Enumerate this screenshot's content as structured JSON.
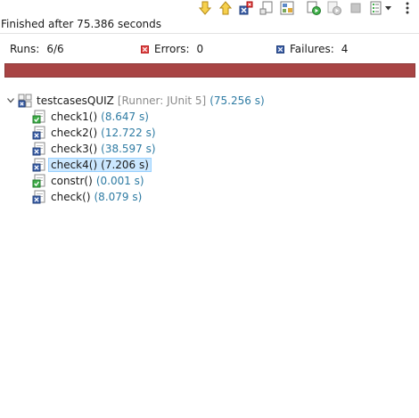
{
  "status": {
    "message": "Finished after 75.386 seconds"
  },
  "counters": {
    "runs_label": "Runs:",
    "runs_value": "6/6",
    "errors_label": "Errors:",
    "errors_value": "0",
    "failures_label": "Failures:",
    "failures_value": "4"
  },
  "progress": {
    "failed": true,
    "fraction": 1.0,
    "color": "#a84444"
  },
  "toolbar": {
    "icons": [
      "next-failure-icon",
      "previous-failure-icon",
      "show-failures-only-icon",
      "scroll-lock-icon",
      "layout-icon",
      "rerun-icon",
      "rerun-failed-first-icon",
      "stop-icon",
      "test-run-history-icon",
      "view-menu-icon"
    ]
  },
  "tree": {
    "root": {
      "label": "testcasesQUIZ",
      "runner": "[Runner: JUnit 5]",
      "time": "(75.256 s)",
      "status": "failed"
    },
    "children": [
      {
        "label": "check1()",
        "time": "(8.647 s)",
        "status": "passed",
        "selected": false
      },
      {
        "label": "check2()",
        "time": "(12.722 s)",
        "status": "failed",
        "selected": false
      },
      {
        "label": "check3()",
        "time": "(38.597 s)",
        "status": "failed",
        "selected": false
      },
      {
        "label": "check4()",
        "time": "(7.206 s)",
        "status": "failed",
        "selected": true
      },
      {
        "label": "constr()",
        "time": "(0.001 s)",
        "status": "passed",
        "selected": false
      },
      {
        "label": "check()",
        "time": "(8.079 s)",
        "status": "failed",
        "selected": false
      }
    ]
  }
}
